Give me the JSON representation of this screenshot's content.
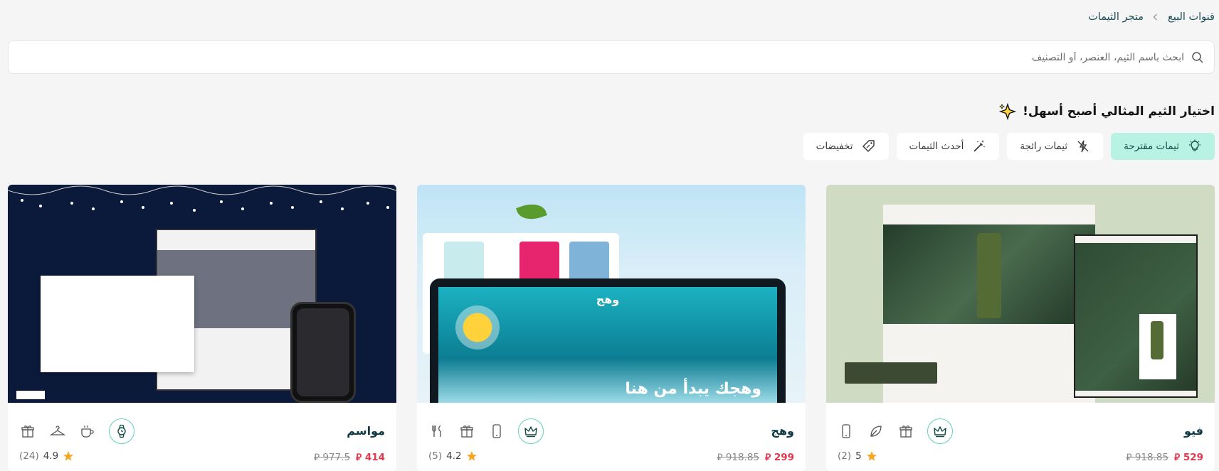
{
  "breadcrumb": {
    "items": [
      "قنوات البيع",
      "متجر الثيمات"
    ]
  },
  "search": {
    "placeholder": "ابحث باسم الثيم، العنصر، أو التصنيف"
  },
  "heading": {
    "text": "اختيار الثيم المثالي أصبح أسهل!"
  },
  "filters": [
    {
      "label": "ثيمات مقترحة",
      "icon": "lightbulb-icon",
      "active": true
    },
    {
      "label": "ثيمات رائجة",
      "icon": "trending-icon",
      "active": false
    },
    {
      "label": "أحدث الثيمات",
      "icon": "magic-wand-icon",
      "active": false
    },
    {
      "label": "تخفيضات",
      "icon": "tag-icon",
      "active": false
    }
  ],
  "themes": [
    {
      "name": "فيو",
      "price": "529",
      "old_price": "918.85",
      "rating": "5",
      "reviews": "(2)",
      "currency": "⃁"
    },
    {
      "name": "وهج",
      "price": "299",
      "old_price": "918.85",
      "rating": "4.2",
      "reviews": "(5)",
      "currency": "⃁"
    },
    {
      "name": "مواسم",
      "price": "414",
      "old_price": "977.5",
      "rating": "4.9",
      "reviews": "(24)",
      "currency": "⃁"
    }
  ],
  "preview_text": {
    "wahj_brand": "وهج",
    "wahj_title": "وهجك يبدأ من هنا"
  },
  "colors": {
    "accent": "#b8f2e2",
    "accent_border": "#5fd3b6",
    "price_red": "#e0384e",
    "star": "#f5a623"
  }
}
